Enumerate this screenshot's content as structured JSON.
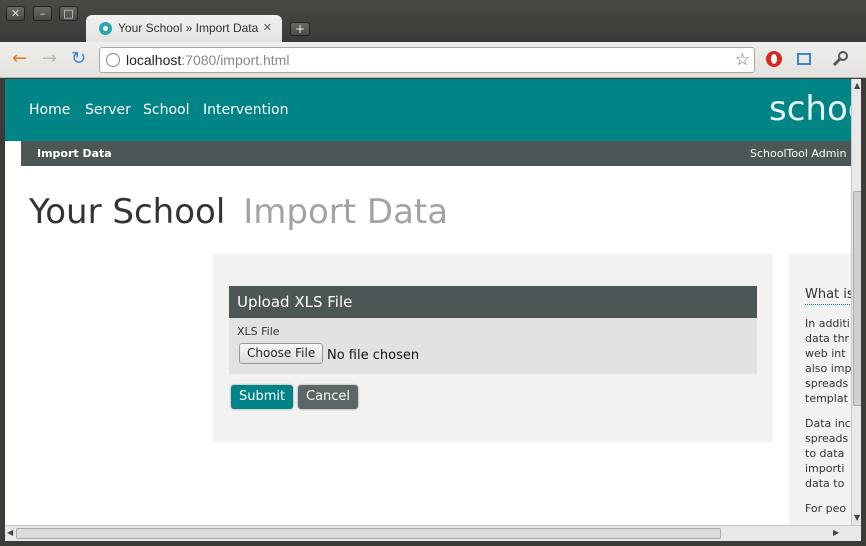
{
  "window": {
    "close_glyph": "✕",
    "minimize_glyph": "–",
    "maximize_glyph": "□"
  },
  "browser": {
    "tab_title": "Your School » Import Data",
    "tab_close": "✕",
    "new_tab": "+",
    "url_host": "localhost",
    "url_path": ":7080/import.html",
    "star_glyph": "☆"
  },
  "topnav": {
    "items": [
      "Home",
      "Server",
      "School",
      "Intervention"
    ],
    "brand": "schoo"
  },
  "subnav": {
    "left": "Import Data",
    "right": "SchoolTool Admin"
  },
  "page": {
    "title": "Your School",
    "subtitle": "Import Data"
  },
  "form": {
    "legend": "Upload XLS File",
    "field_label": "XLS File",
    "file_button": "Choose File",
    "file_status": "No file chosen",
    "submit": "Submit",
    "cancel": "Cancel"
  },
  "aside": {
    "title": "What is",
    "para1": [
      "In additi",
      "data thr",
      "web int",
      "also imp",
      "spreads",
      "templat"
    ],
    "para2": [
      "Data inc",
      "spreads",
      "to data",
      "importi",
      "data to"
    ],
    "para3": [
      "For peo"
    ]
  },
  "colors": {
    "accent": "#008485",
    "dark_bar": "#4d5656"
  }
}
